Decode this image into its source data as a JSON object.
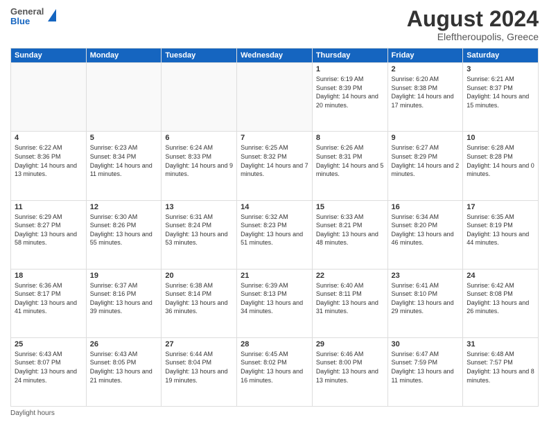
{
  "header": {
    "logo": {
      "line1": "General",
      "line2": "Blue"
    },
    "title": "August 2024",
    "location": "Eleftheroupolis, Greece"
  },
  "weekdays": [
    "Sunday",
    "Monday",
    "Tuesday",
    "Wednesday",
    "Thursday",
    "Friday",
    "Saturday"
  ],
  "weeks": [
    [
      {
        "day": "",
        "info": ""
      },
      {
        "day": "",
        "info": ""
      },
      {
        "day": "",
        "info": ""
      },
      {
        "day": "",
        "info": ""
      },
      {
        "day": "1",
        "info": "Sunrise: 6:19 AM\nSunset: 8:39 PM\nDaylight: 14 hours\nand 20 minutes."
      },
      {
        "day": "2",
        "info": "Sunrise: 6:20 AM\nSunset: 8:38 PM\nDaylight: 14 hours\nand 17 minutes."
      },
      {
        "day": "3",
        "info": "Sunrise: 6:21 AM\nSunset: 8:37 PM\nDaylight: 14 hours\nand 15 minutes."
      }
    ],
    [
      {
        "day": "4",
        "info": "Sunrise: 6:22 AM\nSunset: 8:36 PM\nDaylight: 14 hours\nand 13 minutes."
      },
      {
        "day": "5",
        "info": "Sunrise: 6:23 AM\nSunset: 8:34 PM\nDaylight: 14 hours\nand 11 minutes."
      },
      {
        "day": "6",
        "info": "Sunrise: 6:24 AM\nSunset: 8:33 PM\nDaylight: 14 hours\nand 9 minutes."
      },
      {
        "day": "7",
        "info": "Sunrise: 6:25 AM\nSunset: 8:32 PM\nDaylight: 14 hours\nand 7 minutes."
      },
      {
        "day": "8",
        "info": "Sunrise: 6:26 AM\nSunset: 8:31 PM\nDaylight: 14 hours\nand 5 minutes."
      },
      {
        "day": "9",
        "info": "Sunrise: 6:27 AM\nSunset: 8:29 PM\nDaylight: 14 hours\nand 2 minutes."
      },
      {
        "day": "10",
        "info": "Sunrise: 6:28 AM\nSunset: 8:28 PM\nDaylight: 14 hours\nand 0 minutes."
      }
    ],
    [
      {
        "day": "11",
        "info": "Sunrise: 6:29 AM\nSunset: 8:27 PM\nDaylight: 13 hours\nand 58 minutes."
      },
      {
        "day": "12",
        "info": "Sunrise: 6:30 AM\nSunset: 8:26 PM\nDaylight: 13 hours\nand 55 minutes."
      },
      {
        "day": "13",
        "info": "Sunrise: 6:31 AM\nSunset: 8:24 PM\nDaylight: 13 hours\nand 53 minutes."
      },
      {
        "day": "14",
        "info": "Sunrise: 6:32 AM\nSunset: 8:23 PM\nDaylight: 13 hours\nand 51 minutes."
      },
      {
        "day": "15",
        "info": "Sunrise: 6:33 AM\nSunset: 8:21 PM\nDaylight: 13 hours\nand 48 minutes."
      },
      {
        "day": "16",
        "info": "Sunrise: 6:34 AM\nSunset: 8:20 PM\nDaylight: 13 hours\nand 46 minutes."
      },
      {
        "day": "17",
        "info": "Sunrise: 6:35 AM\nSunset: 8:19 PM\nDaylight: 13 hours\nand 44 minutes."
      }
    ],
    [
      {
        "day": "18",
        "info": "Sunrise: 6:36 AM\nSunset: 8:17 PM\nDaylight: 13 hours\nand 41 minutes."
      },
      {
        "day": "19",
        "info": "Sunrise: 6:37 AM\nSunset: 8:16 PM\nDaylight: 13 hours\nand 39 minutes."
      },
      {
        "day": "20",
        "info": "Sunrise: 6:38 AM\nSunset: 8:14 PM\nDaylight: 13 hours\nand 36 minutes."
      },
      {
        "day": "21",
        "info": "Sunrise: 6:39 AM\nSunset: 8:13 PM\nDaylight: 13 hours\nand 34 minutes."
      },
      {
        "day": "22",
        "info": "Sunrise: 6:40 AM\nSunset: 8:11 PM\nDaylight: 13 hours\nand 31 minutes."
      },
      {
        "day": "23",
        "info": "Sunrise: 6:41 AM\nSunset: 8:10 PM\nDaylight: 13 hours\nand 29 minutes."
      },
      {
        "day": "24",
        "info": "Sunrise: 6:42 AM\nSunset: 8:08 PM\nDaylight: 13 hours\nand 26 minutes."
      }
    ],
    [
      {
        "day": "25",
        "info": "Sunrise: 6:43 AM\nSunset: 8:07 PM\nDaylight: 13 hours\nand 24 minutes."
      },
      {
        "day": "26",
        "info": "Sunrise: 6:43 AM\nSunset: 8:05 PM\nDaylight: 13 hours\nand 21 minutes."
      },
      {
        "day": "27",
        "info": "Sunrise: 6:44 AM\nSunset: 8:04 PM\nDaylight: 13 hours\nand 19 minutes."
      },
      {
        "day": "28",
        "info": "Sunrise: 6:45 AM\nSunset: 8:02 PM\nDaylight: 13 hours\nand 16 minutes."
      },
      {
        "day": "29",
        "info": "Sunrise: 6:46 AM\nSunset: 8:00 PM\nDaylight: 13 hours\nand 13 minutes."
      },
      {
        "day": "30",
        "info": "Sunrise: 6:47 AM\nSunset: 7:59 PM\nDaylight: 13 hours\nand 11 minutes."
      },
      {
        "day": "31",
        "info": "Sunrise: 6:48 AM\nSunset: 7:57 PM\nDaylight: 13 hours\nand 8 minutes."
      }
    ]
  ],
  "footer": "Daylight hours"
}
